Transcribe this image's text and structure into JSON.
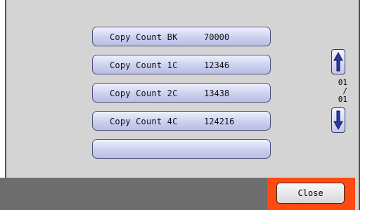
{
  "counts": [
    {
      "label": "Copy Count BK",
      "value": "70000"
    },
    {
      "label": "Copy Count 1C",
      "value": "12346"
    },
    {
      "label": "Copy Count 2C",
      "value": "13438"
    },
    {
      "label": "Copy Count 4C",
      "value": "124216"
    },
    {
      "label": "",
      "value": ""
    }
  ],
  "pager": {
    "current": "01",
    "separator": "/",
    "total": "01"
  },
  "icons": {
    "up": "arrow-up-icon",
    "down": "arrow-down-icon"
  },
  "footer": {
    "close_label": "Close"
  },
  "colors": {
    "highlight": "#ff4a12",
    "button_border": "#4a4f7a",
    "arrow_fill": "#2a3aa5"
  }
}
